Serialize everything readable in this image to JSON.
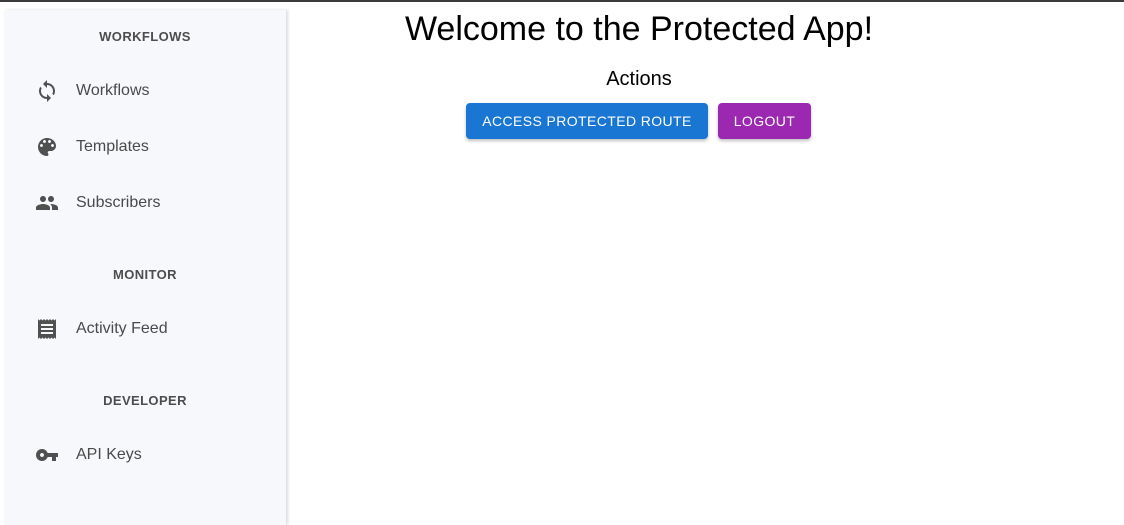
{
  "sidebar": {
    "sections": [
      {
        "title": "WORKFLOWS",
        "items": [
          {
            "label": "Workflows",
            "icon": "sync-icon"
          },
          {
            "label": "Templates",
            "icon": "palette-icon"
          },
          {
            "label": "Subscribers",
            "icon": "people-icon"
          }
        ]
      },
      {
        "title": "MONITOR",
        "items": [
          {
            "label": "Activity Feed",
            "icon": "receipt-icon"
          }
        ]
      },
      {
        "title": "DEVELOPER",
        "items": [
          {
            "label": "API Keys",
            "icon": "key-icon"
          }
        ]
      }
    ]
  },
  "main": {
    "title": "Welcome to the Protected App!",
    "actions_title": "Actions",
    "buttons": {
      "protected_route": "ACCESS PROTECTED ROUTE",
      "logout": "LOGOUT"
    }
  },
  "colors": {
    "primary": "#1976d2",
    "secondary": "#9c27b0",
    "sidebar_bg": "#f7f8fc"
  }
}
